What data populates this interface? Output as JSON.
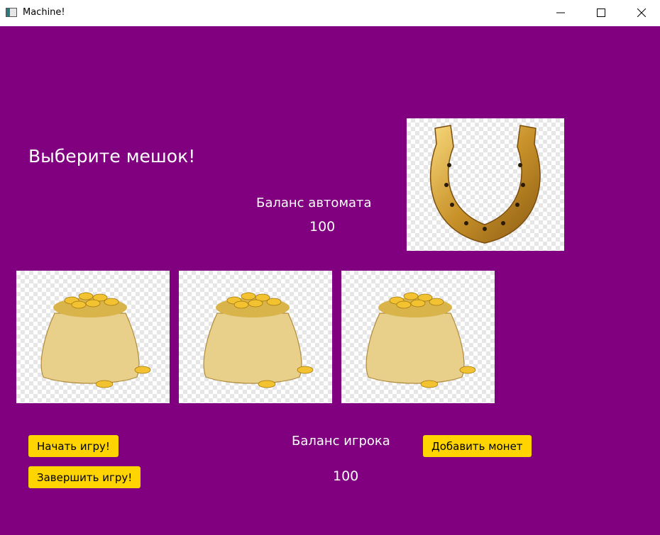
{
  "window": {
    "title": "Machine!"
  },
  "main": {
    "heading": "Выберите мешок!",
    "machine_balance_label": "Баланс автомата",
    "machine_balance_value": "100",
    "player_balance_label": "Баланс игрока",
    "player_balance_value": "100"
  },
  "buttons": {
    "start": "Начать игру!",
    "finish": "Завершить игру!",
    "add_coins": "Добавить монет"
  },
  "colors": {
    "background": "#800080",
    "button": "#ffd400",
    "text": "#ffffff"
  },
  "icons": {
    "horseshoe": "horseshoe-image",
    "bag": "money-bag-image"
  }
}
